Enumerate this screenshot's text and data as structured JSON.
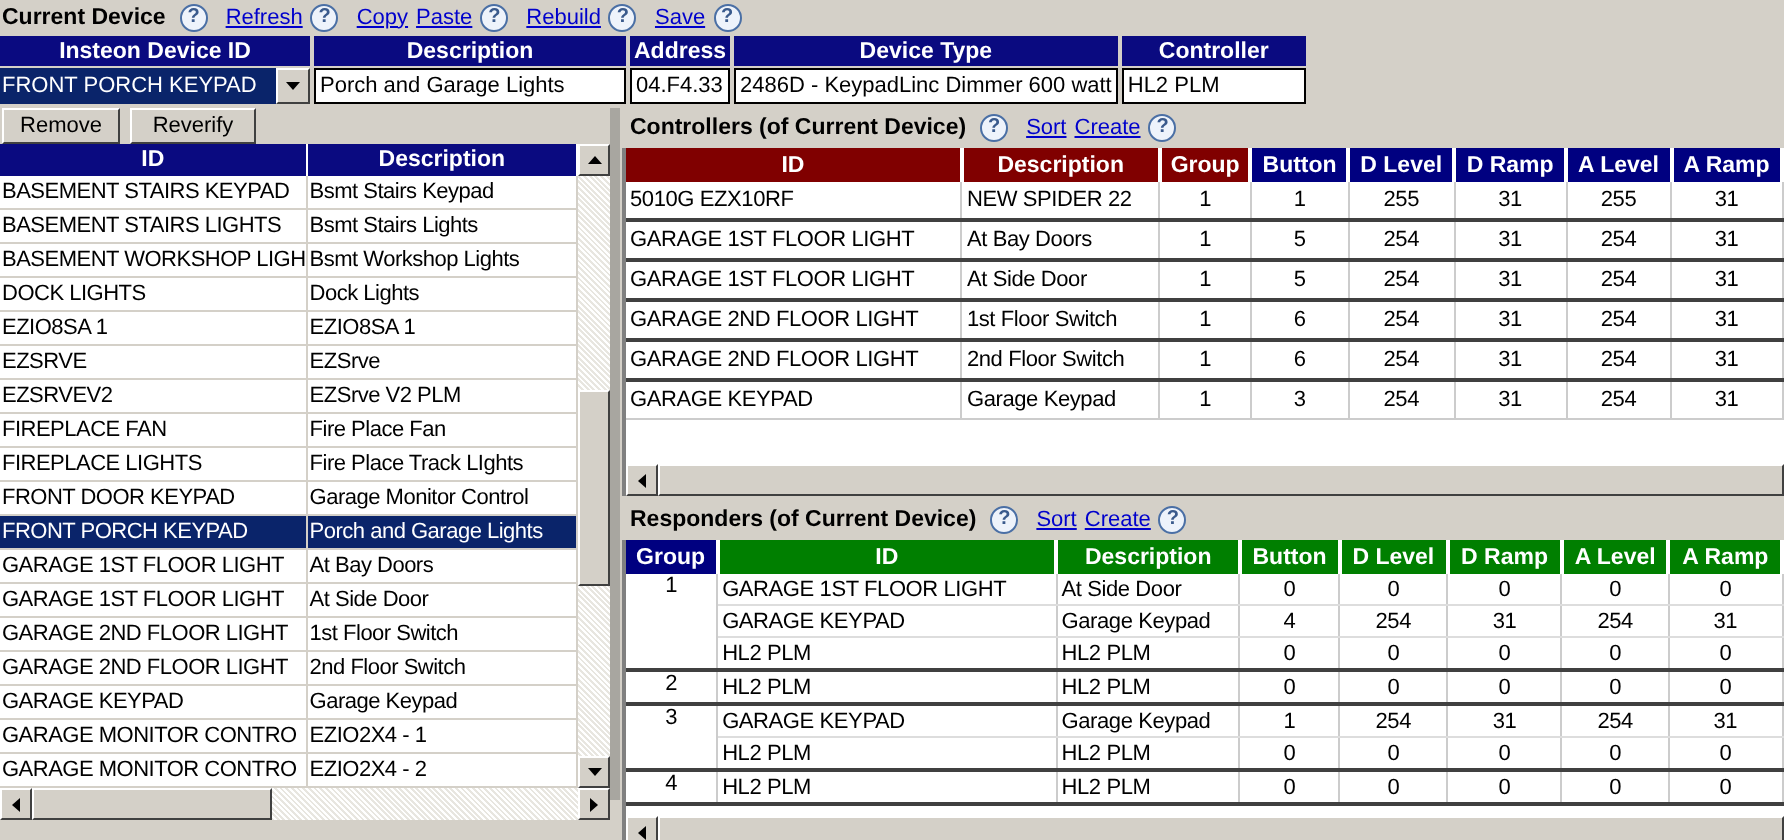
{
  "current_device": {
    "title": "Current Device",
    "help": "?",
    "links": [
      {
        "label": "Refresh",
        "help": "?"
      },
      {
        "label": "Copy"
      },
      {
        "label": "Paste",
        "help": "?"
      },
      {
        "label": "Rebuild",
        "help": "?"
      },
      {
        "label": "Save",
        "help": "?"
      }
    ]
  },
  "device_table": {
    "columns": [
      "Insteon Device ID",
      "Description",
      "Address",
      "Device Type",
      "Controller"
    ],
    "values": {
      "id": "FRONT PORCH KEYPAD",
      "description": "Porch and Garage Lights",
      "address": "04.F4.33",
      "device_type": "2486D - KeypadLinc Dimmer 600 watt",
      "controller": "HL2 PLM"
    }
  },
  "buttons": [
    "Remove",
    "Reverify"
  ],
  "device_list": {
    "columns": [
      "ID",
      "Description"
    ],
    "rows": [
      {
        "id": "BASEMENT STAIRS KEYPAD",
        "description": "Bsmt Stairs Keypad",
        "selected": false
      },
      {
        "id": "BASEMENT STAIRS LIGHTS",
        "description": "Bsmt Stairs Lights",
        "selected": false
      },
      {
        "id": "BASEMENT WORKSHOP LIGH",
        "description": "Bsmt Workshop Lights",
        "selected": false
      },
      {
        "id": "DOCK LIGHTS",
        "description": "Dock Lights",
        "selected": false
      },
      {
        "id": "EZIO8SA 1",
        "description": "EZIO8SA 1",
        "selected": false
      },
      {
        "id": "EZSRVE",
        "description": "EZSrve",
        "selected": false
      },
      {
        "id": "EZSRVEV2",
        "description": "EZSrve V2 PLM",
        "selected": false
      },
      {
        "id": "FIREPLACE FAN",
        "description": "Fire Place Fan",
        "selected": false
      },
      {
        "id": "FIREPLACE LIGHTS",
        "description": "Fire Place Track LIghts",
        "selected": false
      },
      {
        "id": "FRONT DOOR KEYPAD",
        "description": "Garage Monitor Control",
        "selected": false
      },
      {
        "id": "FRONT PORCH KEYPAD",
        "description": "Porch and Garage Lights",
        "selected": true
      },
      {
        "id": "GARAGE 1ST FLOOR LIGHT",
        "description": "At Bay Doors",
        "selected": false
      },
      {
        "id": "GARAGE 1ST FLOOR LIGHT",
        "description": "At Side Door",
        "selected": false
      },
      {
        "id": "GARAGE 2ND FLOOR LIGHT",
        "description": "1st Floor Switch",
        "selected": false
      },
      {
        "id": "GARAGE 2ND FLOOR LIGHT",
        "description": "2nd Floor Switch",
        "selected": false
      },
      {
        "id": "GARAGE KEYPAD",
        "description": "Garage Keypad",
        "selected": false
      },
      {
        "id": "GARAGE MONITOR CONTRO",
        "description": "EZIO2X4 - 1",
        "selected": false
      },
      {
        "id": "GARAGE MONITOR CONTRO",
        "description": "EZIO2X4 - 2",
        "selected": false
      }
    ]
  },
  "controllers": {
    "title": "Controllers (of Current Device)",
    "help": "?",
    "links": [
      {
        "label": "Sort"
      },
      {
        "label": "Create",
        "help": "?"
      }
    ],
    "columns": [
      {
        "label": "ID",
        "color": "#800000"
      },
      {
        "label": "Description",
        "color": "#800000"
      },
      {
        "label": "Group",
        "color": "#800000"
      },
      {
        "label": "Button",
        "color": "#000080"
      },
      {
        "label": "D Level",
        "color": "#000080"
      },
      {
        "label": "D Ramp",
        "color": "#000080"
      },
      {
        "label": "A Level",
        "color": "#000080"
      },
      {
        "label": "A Ramp",
        "color": "#000080"
      }
    ],
    "rows": [
      [
        "5010G EZX10RF",
        "NEW SPIDER 22",
        "1",
        "1",
        "255",
        "31",
        "255",
        "31"
      ],
      [
        "GARAGE 1ST FLOOR LIGHT",
        "At Bay Doors",
        "1",
        "5",
        "254",
        "31",
        "254",
        "31"
      ],
      [
        "GARAGE 1ST FLOOR LIGHT",
        "At Side Door",
        "1",
        "5",
        "254",
        "31",
        "254",
        "31"
      ],
      [
        "GARAGE 2ND FLOOR LIGHT",
        "1st Floor Switch",
        "1",
        "6",
        "254",
        "31",
        "254",
        "31"
      ],
      [
        "GARAGE 2ND FLOOR LIGHT",
        "2nd Floor Switch",
        "1",
        "6",
        "254",
        "31",
        "254",
        "31"
      ],
      [
        "GARAGE KEYPAD",
        "Garage Keypad",
        "1",
        "3",
        "254",
        "31",
        "254",
        "31"
      ]
    ]
  },
  "responders": {
    "title": "Responders (of Current Device)",
    "help": "?",
    "links": [
      {
        "label": "Sort"
      },
      {
        "label": "Create",
        "help": "?"
      }
    ],
    "columns": [
      {
        "label": "Group",
        "color": "#000080"
      },
      {
        "label": "ID",
        "color": "#007f00"
      },
      {
        "label": "Description",
        "color": "#007f00"
      },
      {
        "label": "Button",
        "color": "#007f00"
      },
      {
        "label": "D Level",
        "color": "#007f00"
      },
      {
        "label": "D Ramp",
        "color": "#007f00"
      },
      {
        "label": "A Level",
        "color": "#007f00"
      },
      {
        "label": "A Ramp",
        "color": "#007f00"
      }
    ],
    "groups": [
      {
        "group": "1",
        "rows": [
          [
            "GARAGE 1ST FLOOR LIGHT",
            "At Side Door",
            "0",
            "0",
            "0",
            "0",
            "0"
          ],
          [
            "GARAGE KEYPAD",
            "Garage Keypad",
            "4",
            "254",
            "31",
            "254",
            "31"
          ],
          [
            "HL2 PLM",
            "HL2 PLM",
            "0",
            "0",
            "0",
            "0",
            "0"
          ]
        ]
      },
      {
        "group": "2",
        "rows": [
          [
            "HL2 PLM",
            "HL2 PLM",
            "0",
            "0",
            "0",
            "0",
            "0"
          ]
        ]
      },
      {
        "group": "3",
        "rows": [
          [
            "GARAGE KEYPAD",
            "Garage Keypad",
            "1",
            "254",
            "31",
            "254",
            "31"
          ],
          [
            "HL2 PLM",
            "HL2 PLM",
            "0",
            "0",
            "0",
            "0",
            "0"
          ]
        ]
      },
      {
        "group": "4",
        "rows": [
          [
            "HL2 PLM",
            "HL2 PLM",
            "0",
            "0",
            "0",
            "0",
            "0"
          ]
        ]
      }
    ]
  }
}
